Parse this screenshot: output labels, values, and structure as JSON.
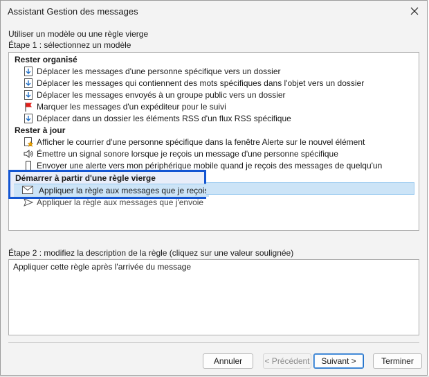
{
  "window": {
    "title": "Assistant Gestion des messages"
  },
  "intro": {
    "line1": "Utiliser un modèle ou une règle vierge",
    "step1": "Étape 1 : sélectionnez un modèle"
  },
  "groups": [
    {
      "header": "Rester organisé",
      "items": [
        {
          "label": "Déplacer les messages d'une personne spécifique vers un dossier",
          "icon": "move-to-folder-icon"
        },
        {
          "label": "Déplacer les messages qui contiennent des mots spécifiques dans l'objet vers un dossier",
          "icon": "move-to-folder-icon"
        },
        {
          "label": "Déplacer les messages envoyés à un groupe public vers un dossier",
          "icon": "move-to-folder-icon"
        },
        {
          "label": "Marquer les messages d'un expéditeur pour le suivi",
          "icon": "red-flag-icon"
        },
        {
          "label": "Déplacer dans un dossier les éléments RSS d'un flux RSS spécifique",
          "icon": "move-to-folder-icon"
        }
      ]
    },
    {
      "header": "Rester à jour",
      "items": [
        {
          "label": "Afficher le courrier d'une personne spécifique dans la fenêtre Alerte sur le nouvel élément",
          "icon": "alert-star-icon"
        },
        {
          "label": "Émettre un signal sonore lorsque je reçois un message d'une personne spécifique",
          "icon": "speaker-icon"
        },
        {
          "label": "Envoyer une alerte vers mon périphérique mobile quand je reçois des messages de quelqu'un",
          "icon": "mobile-device-icon"
        }
      ]
    },
    {
      "header": "Démarrer à partir d'une règle vierge",
      "items": [
        {
          "label": "Appliquer la règle aux messages que je reçois",
          "icon": "envelope-icon",
          "selected": true
        },
        {
          "label": "Appliquer la règle aux messages que j'envoie",
          "icon": "send-arrow-icon"
        }
      ]
    }
  ],
  "step2": {
    "label": "Étape 2 : modifiez la description de la règle (cliquez sur une valeur soulignée)",
    "description": "Appliquer cette règle après l'arrivée du message"
  },
  "buttons": {
    "cancel": "Annuler",
    "previous": "< Précédent",
    "next": "Suivant >",
    "finish": "Terminer"
  },
  "colors": {
    "highlight_border": "#1456d2",
    "selection": "#cce4f7"
  }
}
